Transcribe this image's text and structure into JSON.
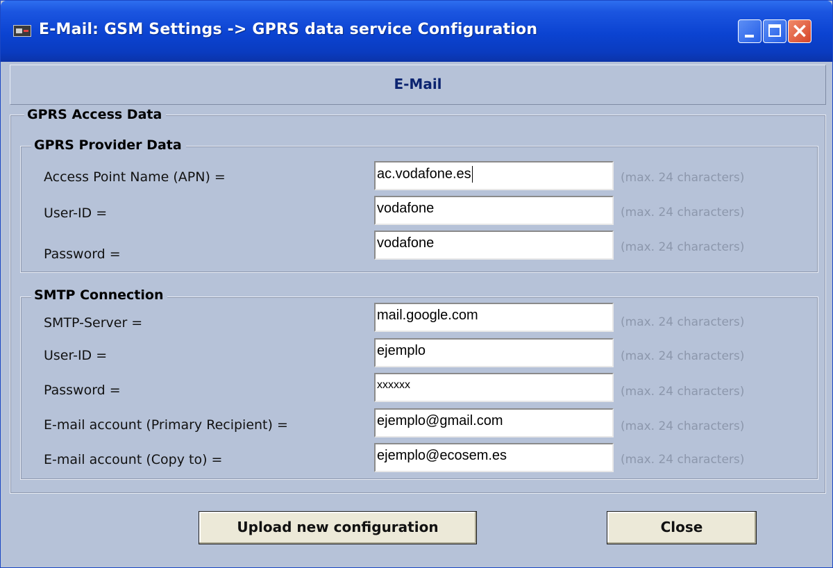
{
  "window": {
    "title": "E-Mail: GSM Settings -> GPRS data service Configuration"
  },
  "banner": {
    "label": "E-Mail"
  },
  "access_group": {
    "legend": "GPRS Access Data"
  },
  "provider": {
    "legend": "GPRS Provider Data",
    "rows": [
      {
        "label": "Access Point Name (APN) =",
        "value": "ac.vodafone.es",
        "hint": "(max. 24 characters)"
      },
      {
        "label": "User-ID =",
        "value": "vodafone",
        "hint": "(max. 24 characters)"
      },
      {
        "label": "Password =",
        "value": "vodafone",
        "hint": "(max. 24 characters)"
      }
    ]
  },
  "smtp": {
    "legend": "SMTP Connection",
    "rows": [
      {
        "label": "SMTP-Server =",
        "value": "mail.google.com",
        "hint": "(max. 24 characters)"
      },
      {
        "label": "User-ID =",
        "value": "ejemplo",
        "hint": "(max. 24 characters)"
      },
      {
        "label": "Password =",
        "value": "xxxxxx",
        "hint": "(max. 24 characters)"
      },
      {
        "label": "E-mail account (Primary Recipient) =",
        "value": "ejemplo@gmail.com",
        "hint": "(max. 24 characters)"
      },
      {
        "label": "E-mail account (Copy to) =",
        "value": "ejemplo@ecosem.es",
        "hint": "(max. 24 characters)"
      }
    ]
  },
  "buttons": {
    "upload": "Upload new configuration",
    "close": "Close"
  },
  "icons": {
    "app": "gsm-device-icon",
    "minimize": "minimize-icon",
    "maximize": "maximize-icon",
    "close": "close-icon"
  },
  "colors": {
    "titlebar": "#0b43d1",
    "dialog_bg": "#b6c2d8",
    "banner_text": "#0c2470",
    "hint_text": "#8c97ac"
  }
}
